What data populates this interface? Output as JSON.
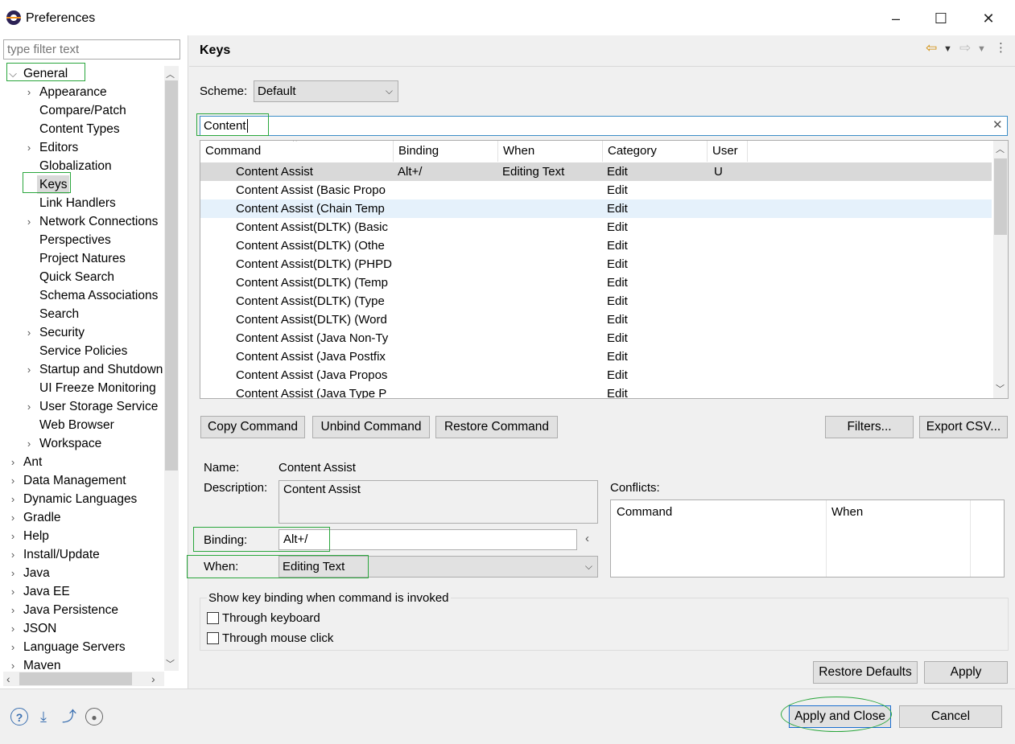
{
  "window": {
    "title": "Preferences",
    "minimize": "–",
    "maximize": "☐",
    "close": "✕"
  },
  "filter": {
    "placeholder": "type filter text"
  },
  "tree": [
    {
      "label": "General",
      "chevron": "⌵",
      "indent": 0
    },
    {
      "label": "Appearance",
      "chevron": "›",
      "indent": 1
    },
    {
      "label": "Compare/Patch",
      "chevron": "",
      "indent": 1
    },
    {
      "label": "Content Types",
      "chevron": "",
      "indent": 1
    },
    {
      "label": "Editors",
      "chevron": "›",
      "indent": 1
    },
    {
      "label": "Globalization",
      "chevron": "",
      "indent": 1
    },
    {
      "label": "Keys",
      "chevron": "",
      "indent": 1
    },
    {
      "label": "Link Handlers",
      "chevron": "",
      "indent": 1
    },
    {
      "label": "Network Connections",
      "chevron": "›",
      "indent": 1
    },
    {
      "label": "Perspectives",
      "chevron": "",
      "indent": 1
    },
    {
      "label": "Project Natures",
      "chevron": "",
      "indent": 1
    },
    {
      "label": "Quick Search",
      "chevron": "",
      "indent": 1
    },
    {
      "label": "Schema Associations",
      "chevron": "",
      "indent": 1
    },
    {
      "label": "Search",
      "chevron": "",
      "indent": 1
    },
    {
      "label": "Security",
      "chevron": "›",
      "indent": 1
    },
    {
      "label": "Service Policies",
      "chevron": "",
      "indent": 1
    },
    {
      "label": "Startup and Shutdown",
      "chevron": "›",
      "indent": 1
    },
    {
      "label": "UI Freeze Monitoring",
      "chevron": "",
      "indent": 1
    },
    {
      "label": "User Storage Service",
      "chevron": "›",
      "indent": 1
    },
    {
      "label": "Web Browser",
      "chevron": "",
      "indent": 1
    },
    {
      "label": "Workspace",
      "chevron": "›",
      "indent": 1
    },
    {
      "label": "Ant",
      "chevron": "›",
      "indent": 0
    },
    {
      "label": "Data Management",
      "chevron": "›",
      "indent": 0
    },
    {
      "label": "Dynamic Languages",
      "chevron": "›",
      "indent": 0
    },
    {
      "label": "Gradle",
      "chevron": "›",
      "indent": 0
    },
    {
      "label": "Help",
      "chevron": "›",
      "indent": 0
    },
    {
      "label": "Install/Update",
      "chevron": "›",
      "indent": 0
    },
    {
      "label": "Java",
      "chevron": "›",
      "indent": 0
    },
    {
      "label": "Java EE",
      "chevron": "›",
      "indent": 0
    },
    {
      "label": "Java Persistence",
      "chevron": "›",
      "indent": 0
    },
    {
      "label": "JSON",
      "chevron": "›",
      "indent": 0
    },
    {
      "label": "Language Servers",
      "chevron": "›",
      "indent": 0
    },
    {
      "label": "Maven",
      "chevron": "›",
      "indent": 0
    }
  ],
  "tree_selected": "Keys",
  "page": {
    "title": "Keys"
  },
  "scheme": {
    "label": "Scheme:",
    "value": "Default"
  },
  "search": {
    "value": "Content"
  },
  "table": {
    "columns": [
      "Command",
      "Binding",
      "When",
      "Category",
      "User"
    ],
    "rows": [
      [
        "Content Assist",
        "Alt+/",
        "Editing Text",
        "Edit",
        "U"
      ],
      [
        "Content Assist (Basic Propo",
        "",
        "",
        "Edit",
        ""
      ],
      [
        "Content Assist (Chain Temp",
        "",
        "",
        "Edit",
        ""
      ],
      [
        "Content Assist(DLTK) (Basic",
        "",
        "",
        "Edit",
        ""
      ],
      [
        "Content Assist(DLTK) (Othe",
        "",
        "",
        "Edit",
        ""
      ],
      [
        "Content Assist(DLTK) (PHPD",
        "",
        "",
        "Edit",
        ""
      ],
      [
        "Content Assist(DLTK) (Temp",
        "",
        "",
        "Edit",
        ""
      ],
      [
        "Content Assist(DLTK) (Type",
        "",
        "",
        "Edit",
        ""
      ],
      [
        "Content Assist(DLTK) (Word",
        "",
        "",
        "Edit",
        ""
      ],
      [
        "Content Assist (Java Non-Ty",
        "",
        "",
        "Edit",
        ""
      ],
      [
        "Content Assist (Java Postfix",
        "",
        "",
        "Edit",
        ""
      ],
      [
        "Content Assist (Java Propos",
        "",
        "",
        "Edit",
        ""
      ],
      [
        "Content Assist (Java Type P",
        "",
        "",
        "Edit",
        ""
      ]
    ]
  },
  "buttons": {
    "copy": "Copy Command",
    "unbind": "Unbind Command",
    "restore": "Restore Command",
    "filters": "Filters...",
    "export": "Export CSV...",
    "restore_defaults": "Restore Defaults",
    "apply": "Apply",
    "apply_close": "Apply and Close",
    "cancel": "Cancel"
  },
  "details": {
    "name_label": "Name:",
    "name_value": "Content Assist",
    "description_label": "Description:",
    "description_value": "Content Assist",
    "binding_label": "Binding:",
    "binding_value": "Alt+/",
    "when_label": "When:",
    "when_value": "Editing Text",
    "conflicts_label": "Conflicts:",
    "conflicts_columns": [
      "Command",
      "When"
    ]
  },
  "show_binding": {
    "title": "Show key binding when command is invoked",
    "through_keyboard": "Through keyboard",
    "through_mouse": "Through mouse click"
  },
  "icons": {
    "help": "help-icon",
    "import": "import-icon",
    "export": "export-icon",
    "record": "record-icon"
  },
  "colors": {
    "highlight_box": "#2aa63c",
    "selection": "#d9d9d9",
    "hover_row": "#e5f1fb"
  }
}
